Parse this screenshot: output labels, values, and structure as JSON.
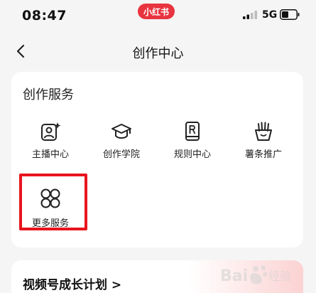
{
  "status_bar": {
    "time": "08:47",
    "app_badge": "小红书",
    "network": "5G"
  },
  "nav": {
    "title": "创作中心",
    "back_icon": "chevron-left-icon"
  },
  "creation_services": {
    "title": "创作服务",
    "items": [
      {
        "label": "主播中心",
        "icon": "streamer-avatar-icon"
      },
      {
        "label": "创作学院",
        "icon": "graduation-cap-icon"
      },
      {
        "label": "规则中心",
        "icon": "rulebook-icon"
      },
      {
        "label": "薯条推广",
        "icon": "fries-icon"
      },
      {
        "label": "更多服务",
        "icon": "four-circles-icon"
      }
    ]
  },
  "growth_plan": {
    "title": "视频号成长计划 >"
  },
  "watermark": {
    "text": "Bai经验"
  },
  "colors": {
    "accent": "#e8343f",
    "highlight_border": "#e8141e",
    "background": "#f5f5f5"
  }
}
